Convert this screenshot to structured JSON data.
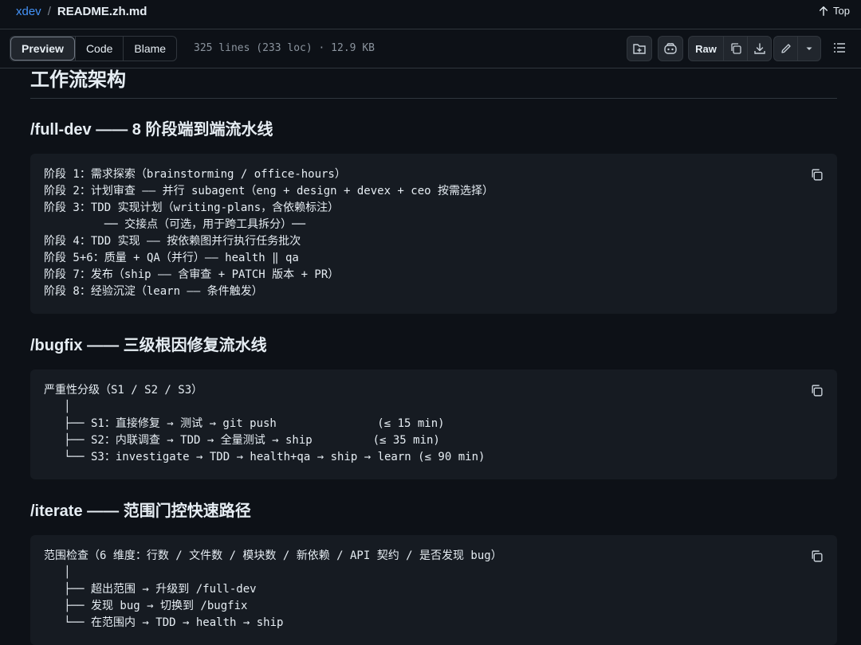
{
  "breadcrumb": {
    "repo": "xdev",
    "separator": "/",
    "file": "README.zh.md"
  },
  "top_link": {
    "label": "Top",
    "icon": "arrow-up-icon"
  },
  "view_tabs": [
    "Preview",
    "Code",
    "Blame"
  ],
  "file_meta": "325 lines (233 loc) · 12.9 KB",
  "toolbar": {
    "raw_label": "Raw",
    "icons": [
      "new-file-icon",
      "copilot-icon",
      "copy-icon",
      "download-icon",
      "pencil-icon",
      "chevron-down-icon",
      "list-icon"
    ]
  },
  "doc": {
    "heading": "工作流架构",
    "sections": [
      {
        "title": "/full-dev —— 8 阶段端到端流水线",
        "lines": [
          "阶段 1：需求探索（brainstorming / office-hours）",
          "阶段 2：计划审查 —— 并行 subagent（eng + design + devex + ceo 按需选择）",
          "阶段 3：TDD 实现计划（writing-plans，含依赖标注）",
          "         ── 交接点（可选，用于跨工具拆分）──",
          "阶段 4：TDD 实现 —— 按依赖图并行执行任务批次",
          "阶段 5+6：质量 + QA（并行）—— health ‖ qa",
          "阶段 7：发布（ship —— 含审查 + PATCH 版本 + PR）",
          "阶段 8：经验沉淀（learn —— 条件触发）"
        ]
      },
      {
        "title": "/bugfix —— 三级根因修复流水线",
        "lines": [
          "严重性分级（S1 / S2 / S3）",
          "   │",
          "   ├── S1：直接修复 → 测试 → git push               (≤ 15 min)",
          "   ├── S2：内联调查 → TDD → 全量测试 → ship         (≤ 35 min)",
          "   └── S3：investigate → TDD → health+qa → ship → learn (≤ 90 min)"
        ]
      },
      {
        "title": "/iterate —— 范围门控快速路径",
        "lines": [
          "范围检查（6 维度：行数 / 文件数 / 模块数 / 新依赖 / API 契约 / 是否发现 bug）",
          "   │",
          "   ├── 超出范围 → 升级到 /full-dev",
          "   ├── 发现 bug → 切换到 /bugfix",
          "   └── 在范围内 → TDD → health → ship"
        ]
      }
    ]
  }
}
